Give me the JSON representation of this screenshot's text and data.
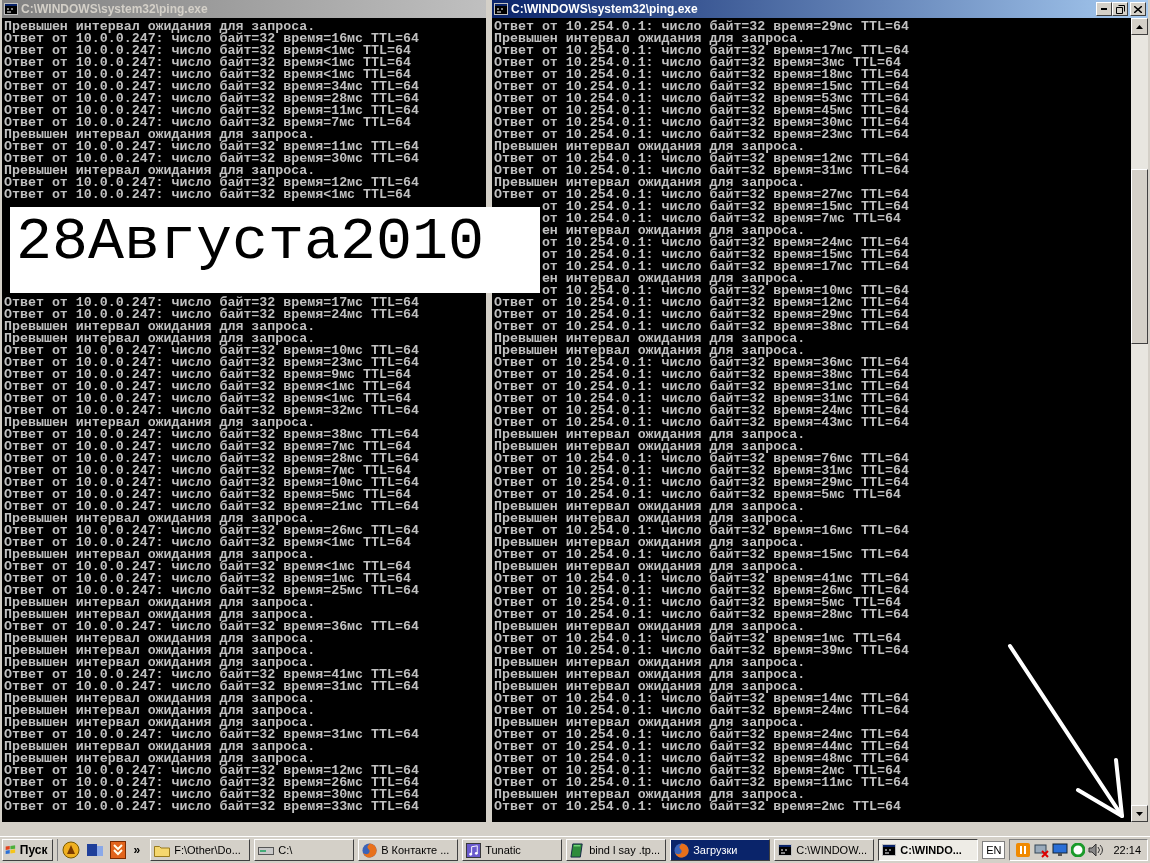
{
  "windows": [
    {
      "title": "C:\\WINDOWS\\system32\\ping.exe",
      "active": false,
      "lines_top": [
        "Превышен интервал ожидания для запроса.",
        "Ответ от 10.0.0.247: число байт=32 время=16мс TTL=64",
        "Ответ от 10.0.0.247: число байт=32 время<1мс TTL=64",
        "Ответ от 10.0.0.247: число байт=32 время<1мс TTL=64",
        "Ответ от 10.0.0.247: число байт=32 время<1мс TTL=64",
        "Ответ от 10.0.0.247: число байт=32 время=34мс TTL=64",
        "Ответ от 10.0.0.247: число байт=32 время=28мс TTL=64",
        "Ответ от 10.0.0.247: число байт=32 время=11мс TTL=64",
        "Ответ от 10.0.0.247: число байт=32 время=7мс TTL=64",
        "Превышен интервал ожидания для запроса.",
        "Ответ от 10.0.0.247: число байт=32 время=11мс TTL=64",
        "Ответ от 10.0.0.247: число байт=32 время=30мс TTL=64",
        "Превышен интервал ожидания для запроса.",
        "Ответ от 10.0.0.247: число байт=32 время=12мс TTL=64",
        "Ответ от 10.0.0.247: число байт=32 время<1мс TTL=64"
      ],
      "lines_bottom": [
        "Ответ от 10.0.0.247: число байт=32 время=17мс TTL=64",
        "Ответ от 10.0.0.247: число байт=32 время=24мс TTL=64",
        "Превышен интервал ожидания для запроса.",
        "Превышен интервал ожидания для запроса.",
        "Ответ от 10.0.0.247: число байт=32 время=10мс TTL=64",
        "Ответ от 10.0.0.247: число байт=32 время=23мс TTL=64",
        "Ответ от 10.0.0.247: число байт=32 время=9мс TTL=64",
        "Ответ от 10.0.0.247: число байт=32 время<1мс TTL=64",
        "Ответ от 10.0.0.247: число байт=32 время<1мс TTL=64",
        "Ответ от 10.0.0.247: число байт=32 время=32мс TTL=64",
        "Превышен интервал ожидания для запроса.",
        "Ответ от 10.0.0.247: число байт=32 время=38мс TTL=64",
        "Ответ от 10.0.0.247: число байт=32 время=7мс TTL=64",
        "Ответ от 10.0.0.247: число байт=32 время=28мс TTL=64",
        "Ответ от 10.0.0.247: число байт=32 время=7мс TTL=64",
        "Ответ от 10.0.0.247: число байт=32 время=10мс TTL=64",
        "Ответ от 10.0.0.247: число байт=32 время=5мс TTL=64",
        "Ответ от 10.0.0.247: число байт=32 время=21мс TTL=64",
        "Превышен интервал ожидания для запроса.",
        "Ответ от 10.0.0.247: число байт=32 время=26мс TTL=64",
        "Ответ от 10.0.0.247: число байт=32 время<1мс TTL=64",
        "Превышен интервал ожидания для запроса.",
        "Ответ от 10.0.0.247: число байт=32 время<1мс TTL=64",
        "Ответ от 10.0.0.247: число байт=32 время=1мс TTL=64",
        "Ответ от 10.0.0.247: число байт=32 время=25мс TTL=64",
        "Превышен интервал ожидания для запроса.",
        "Превышен интервал ожидания для запроса.",
        "Ответ от 10.0.0.247: число байт=32 время=36мс TTL=64",
        "Превышен интервал ожидания для запроса.",
        "Превышен интервал ожидания для запроса.",
        "Превышен интервал ожидания для запроса.",
        "Ответ от 10.0.0.247: число байт=32 время=41мс TTL=64",
        "Ответ от 10.0.0.247: число байт=32 время=31мс TTL=64",
        "Превышен интервал ожидания для запроса.",
        "Превышен интервал ожидания для запроса.",
        "Превышен интервал ожидания для запроса.",
        "Ответ от 10.0.0.247: число байт=32 время=31мс TTL=64",
        "Превышен интервал ожидания для запроса.",
        "Превышен интервал ожидания для запроса.",
        "Ответ от 10.0.0.247: число байт=32 время=12мс TTL=64",
        "Ответ от 10.0.0.247: число байт=32 время=26мс TTL=64",
        "Ответ от 10.0.0.247: число байт=32 время=30мс TTL=64",
        "Ответ от 10.0.0.247: число байт=32 время=33мс TTL=64"
      ]
    },
    {
      "title": "C:\\WINDOWS\\system32\\ping.exe",
      "active": true,
      "lines_top": [
        "Ответ от 10.254.0.1: число байт=32 время=29мс TTL=64",
        "Превышен интервал ожидания для запроса.",
        "Ответ от 10.254.0.1: число байт=32 время=17мс TTL=64",
        "Ответ от 10.254.0.1: число байт=32 время=3мс TTL=64",
        "Ответ от 10.254.0.1: число байт=32 время=18мс TTL=64",
        "Ответ от 10.254.0.1: число байт=32 время=15мс TTL=64",
        "Ответ от 10.254.0.1: число байт=32 время=53мс TTL=64",
        "Ответ от 10.254.0.1: число байт=32 время=45мс TTL=64",
        "Ответ от 10.254.0.1: число байт=32 время=30мс TTL=64",
        "Ответ от 10.254.0.1: число байт=32 время=23мс TTL=64",
        "Превышен интервал ожидания для запроса.",
        "Ответ от 10.254.0.1: число байт=32 время=12мс TTL=64",
        "Ответ от 10.254.0.1: число байт=32 время=31мс TTL=64",
        "Превышен интервал ожидания для запроса.",
        "Ответ от 10.254.0.1: число байт=32 время=27мс TTL=64"
      ],
      "lines_partly_covered": [
        "от 10.254.0.1: число байт=32 время=15мс TTL=64",
        "от 10.254.0.1: число байт=32 время=7мс TTL=64",
        "ен интервал ожидания для запроса.",
        "от 10.254.0.1: число байт=32 время=24мс TTL=64",
        "от 10.254.0.1: число байт=32 время=15мс TTL=64",
        "от 10.254.0.1: число байт=32 время=17мс TTL=64",
        "ен интервал ожидания для запроса.",
        "от 10.254.0.1: число байт=32 время=10мс TTL=64"
      ],
      "lines_bottom": [
        "Ответ от 10.254.0.1: число байт=32 время=12мс TTL=64",
        "Ответ от 10.254.0.1: число байт=32 время=29мс TTL=64",
        "Ответ от 10.254.0.1: число байт=32 время=38мс TTL=64",
        "Превышен интервал ожидания для запроса.",
        "Превышен интервал ожидания для запроса.",
        "Ответ от 10.254.0.1: число байт=32 время=36мс TTL=64",
        "Ответ от 10.254.0.1: число байт=32 время=38мс TTL=64",
        "Ответ от 10.254.0.1: число байт=32 время=31мс TTL=64",
        "Ответ от 10.254.0.1: число байт=32 время=31мс TTL=64",
        "Ответ от 10.254.0.1: число байт=32 время=24мс TTL=64",
        "Ответ от 10.254.0.1: число байт=32 время=43мс TTL=64",
        "Превышен интервал ожидания для запроса.",
        "Превышен интервал ожидания для запроса.",
        "Ответ от 10.254.0.1: число байт=32 время=76мс TTL=64",
        "Ответ от 10.254.0.1: число байт=32 время=31мс TTL=64",
        "Ответ от 10.254.0.1: число байт=32 время=29мс TTL=64",
        "Ответ от 10.254.0.1: число байт=32 время=5мс TTL=64",
        "Превышен интервал ожидания для запроса.",
        "Превышен интервал ожидания для запроса.",
        "Ответ от 10.254.0.1: число байт=32 время=16мс TTL=64",
        "Превышен интервал ожидания для запроса.",
        "Ответ от 10.254.0.1: число байт=32 время=15мс TTL=64",
        "Превышен интервал ожидания для запроса.",
        "Ответ от 10.254.0.1: число байт=32 время=41мс TTL=64",
        "Ответ от 10.254.0.1: число байт=32 время=26мс TTL=64",
        "Ответ от 10.254.0.1: число байт=32 время=5мс TTL=64",
        "Ответ от 10.254.0.1: число байт=32 время=28мс TTL=64",
        "Превышен интервал ожидания для запроса.",
        "Ответ от 10.254.0.1: число байт=32 время=1мс TTL=64",
        "Ответ от 10.254.0.1: число байт=32 время=39мс TTL=64",
        "Превышен интервал ожидания для запроса.",
        "Превышен интервал ожидания для запроса.",
        "Превышен интервал ожидания для запроса.",
        "Ответ от 10.254.0.1: число байт=32 время=14мс TTL=64",
        "Ответ от 10.254.0.1: число байт=32 время=24мс TTL=64",
        "Превышен интервал ожидания для запроса.",
        "Ответ от 10.254.0.1: число байт=32 время=24мс TTL=64",
        "Ответ от 10.254.0.1: число байт=32 время=44мс TTL=64",
        "Ответ от 10.254.0.1: число байт=32 время=48мс TTL=64",
        "Ответ от 10.254.0.1: число байт=32 время=2мс TTL=64",
        "Ответ от 10.254.0.1: число байт=32 время=11мс TTL=64",
        "Превышен интервал ожидания для запроса.",
        "Ответ от 10.254.0.1: число байт=32 время=2мс TTL=64"
      ]
    }
  ],
  "caption": "28Августа2010",
  "taskbar": {
    "start_label": "Пуск",
    "more": "»",
    "tasks": [
      {
        "kind": "folder",
        "label": "F:\\Other\\Do...",
        "selected": false,
        "flashing": false
      },
      {
        "kind": "drive",
        "label": "C:\\",
        "selected": false,
        "flashing": false
      },
      {
        "kind": "browser",
        "label": "В Контакте ...",
        "selected": false,
        "flashing": false
      },
      {
        "kind": "music",
        "label": "Tunatic",
        "selected": false,
        "flashing": false
      },
      {
        "kind": "book",
        "label": "bind l say .tp...",
        "selected": false,
        "flashing": false
      },
      {
        "kind": "browser",
        "label": "Загрузки",
        "selected": false,
        "flashing": true
      },
      {
        "kind": "console",
        "label": "C:\\WINDOW...",
        "selected": false,
        "flashing": false
      },
      {
        "kind": "console",
        "label": "C:\\WINDO...",
        "selected": true,
        "flashing": false
      }
    ],
    "language": "EN",
    "clock": "22:14"
  }
}
